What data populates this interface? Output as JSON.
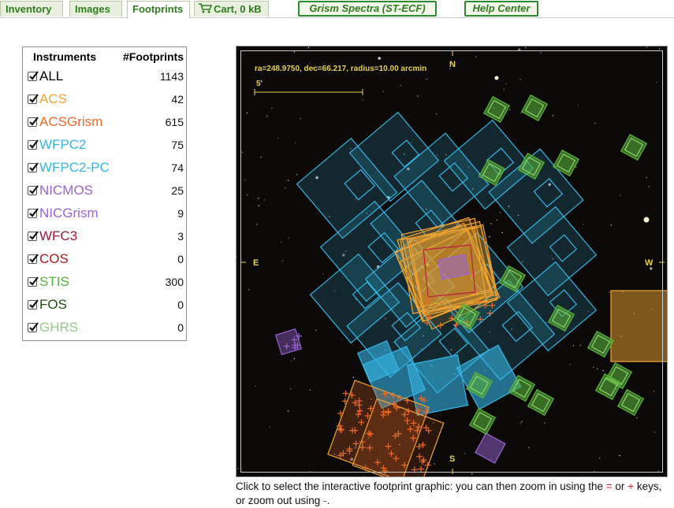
{
  "tabs": [
    {
      "label": "Inventory"
    },
    {
      "label": "Images"
    },
    {
      "label": "Footprints"
    },
    {
      "label": "Cart, 0 kB"
    },
    {
      "label": "Grism Spectra (ST-ECF)"
    },
    {
      "label": "Help Center"
    }
  ],
  "instruments": {
    "header_name": "Instruments",
    "header_count": "#Footprints",
    "rows": [
      {
        "name": "ALL",
        "count": "1143",
        "color": "#000000"
      },
      {
        "name": "ACS",
        "count": "42",
        "color": "#f2a531"
      },
      {
        "name": "ACSGrism",
        "count": "615",
        "color": "#ee6a2a"
      },
      {
        "name": "WFPC2",
        "count": "75",
        "color": "#35b6e6"
      },
      {
        "name": "WFPC2-PC",
        "count": "74",
        "color": "#35b6e6"
      },
      {
        "name": "NICMOS",
        "count": "25",
        "color": "#9a63d6"
      },
      {
        "name": "NICGrism",
        "count": "9",
        "color": "#9a63d6"
      },
      {
        "name": "WFC3",
        "count": "3",
        "color": "#9e1c3a"
      },
      {
        "name": "COS",
        "count": "0",
        "color": "#b01a1a"
      },
      {
        "name": "STIS",
        "count": "300",
        "color": "#59b13a"
      },
      {
        "name": "FOS",
        "count": "0",
        "color": "#234d18"
      },
      {
        "name": "GHRS",
        "count": "0",
        "color": "#96c98a"
      }
    ]
  },
  "sky": {
    "coords": "ra=248.9750, dec=66.217, radius=10.00 arcmin",
    "scale_label": "5'",
    "north": "N",
    "south": "S",
    "east": "E",
    "west": "W"
  },
  "caption": {
    "part1": "Click to select the interactive footprint graphic: you can then zoom in using the ",
    "key_equals": "=",
    "part2": " or ",
    "key_plus": "+",
    "part3": " keys, or zoom out using ",
    "key_minus": "-",
    "part4": "."
  }
}
